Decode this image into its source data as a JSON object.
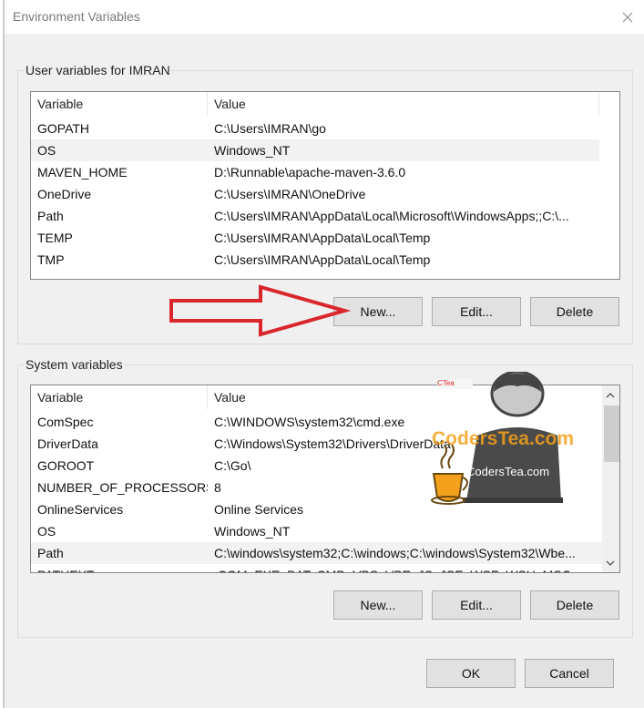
{
  "window": {
    "title": "Environment Variables"
  },
  "user_section": {
    "label": "User variables for IMRAN",
    "columns": [
      "Variable",
      "Value"
    ],
    "rows": [
      {
        "name": "GOPATH",
        "value": "C:\\Users\\IMRAN\\go"
      },
      {
        "name": "OS",
        "value": "Windows_NT"
      },
      {
        "name": "MAVEN_HOME",
        "value": "D:\\Runnable\\apache-maven-3.6.0"
      },
      {
        "name": "OneDrive",
        "value": "C:\\Users\\IMRAN\\OneDrive"
      },
      {
        "name": "Path",
        "value": "C:\\Users\\IMRAN\\AppData\\Local\\Microsoft\\WindowsApps;;C:\\..."
      },
      {
        "name": "TEMP",
        "value": "C:\\Users\\IMRAN\\AppData\\Local\\Temp"
      },
      {
        "name": "TMP",
        "value": "C:\\Users\\IMRAN\\AppData\\Local\\Temp"
      }
    ],
    "buttons": {
      "new": "New...",
      "edit": "Edit...",
      "delete": "Delete"
    }
  },
  "system_section": {
    "label": "System variables",
    "columns": [
      "Variable",
      "Value"
    ],
    "rows": [
      {
        "name": "ComSpec",
        "value": "C:\\WINDOWS\\system32\\cmd.exe"
      },
      {
        "name": "DriverData",
        "value": "C:\\Windows\\System32\\Drivers\\DriverData"
      },
      {
        "name": "GOROOT",
        "value": "C:\\Go\\"
      },
      {
        "name": "NUMBER_OF_PROCESSORS",
        "value": "8"
      },
      {
        "name": "OnlineServices",
        "value": "Online Services"
      },
      {
        "name": "OS",
        "value": "Windows_NT"
      },
      {
        "name": "Path",
        "value": "C:\\windows\\system32;C:\\windows;C:\\windows\\System32\\Wbe..."
      },
      {
        "name": "PATHEXT",
        "value": ".COM;.EXE;.BAT;.CMD;.VBS;.VBE;.JS;.JSE;.WSF;.WSH;.MSC"
      }
    ],
    "buttons": {
      "new": "New...",
      "edit": "Edit...",
      "delete": "Delete"
    }
  },
  "footer": {
    "ok": "OK",
    "cancel": "Cancel"
  },
  "watermark": {
    "brand": "CodersTea.com",
    "small": "CTea"
  },
  "colors": {
    "arrow": "#d9262c",
    "watermark_orange": "#f3a01a",
    "selection": "#f2f2f2"
  },
  "icons": [
    "close-icon",
    "scroll-up-icon",
    "scroll-down-icon",
    "red-arrow-annotation",
    "coders-tea-logo"
  ]
}
